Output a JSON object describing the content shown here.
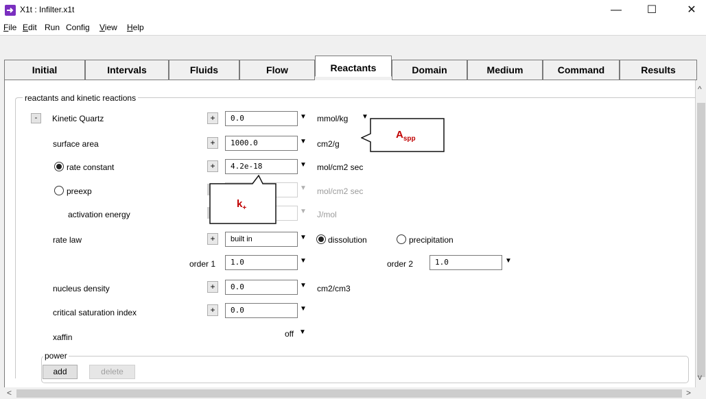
{
  "window": {
    "title": "X1t : Infilter.x1t",
    "controls": {
      "minimize": "—",
      "maximize": "☐",
      "close": "✕"
    }
  },
  "menu": [
    {
      "label": "File",
      "key": "F",
      "rest": "ile"
    },
    {
      "label": "Edit",
      "key": "E",
      "rest": "dit"
    },
    {
      "label": "Run",
      "key": "",
      "rest": "Run"
    },
    {
      "label": "Config",
      "key": "",
      "rest": "Config"
    },
    {
      "label": "View",
      "key": "V",
      "rest": "iew"
    },
    {
      "label": "Help",
      "key": "H",
      "rest": "elp"
    }
  ],
  "tabs": [
    "Initial",
    "Intervals",
    "Fluids",
    "Flow",
    "Reactants",
    "Domain",
    "Medium",
    "Command",
    "Results"
  ],
  "active_tab": "Reactants",
  "group_title": "reactants and kinetic reactions",
  "reactant": {
    "collapse_symbol": "-",
    "name": "Kinetic  Quartz",
    "amount": "0.0",
    "amount_unit": "mmol/kg"
  },
  "rows": {
    "surface_area": {
      "label": "surface area",
      "value": "1000.0",
      "unit": "cm2/g"
    },
    "rate_constant": {
      "label": "rate constant",
      "value": "4.2e-18",
      "unit": "mol/cm2 sec"
    },
    "preexp": {
      "label": "preexp",
      "value": "",
      "unit": "mol/cm2 sec"
    },
    "activation_energy": {
      "label": "activation energy",
      "value": "",
      "unit": "J/mol"
    },
    "rate_law": {
      "label": "rate law",
      "value": "built in",
      "dissolution": "dissolution",
      "precipitation": "precipitation"
    },
    "orders": {
      "order1_label": "order 1",
      "order1_value": "1.0",
      "order2_label": "order 2",
      "order2_value": "1.0"
    },
    "nucleus_density": {
      "label": "nucleus density",
      "value": "0.0",
      "unit": "cm2/cm3"
    },
    "critical_saturation": {
      "label": "critical saturation index",
      "value": "0.0"
    },
    "xaffin": {
      "label": "xaffin",
      "value": "off"
    }
  },
  "plus_symbol": "+",
  "caret_symbol": "▼",
  "power": {
    "label": "power",
    "add": "add",
    "delete": "delete"
  },
  "callouts": {
    "aspp_main": "A",
    "aspp_sub": "spp",
    "kplus_main": "k",
    "kplus_sub": "+"
  },
  "scroll": {
    "up": "^",
    "down": "v",
    "left": "<",
    "right": ">"
  },
  "colors": {
    "callout_text": "#c00000",
    "app_icon": "#7a2fbf"
  }
}
